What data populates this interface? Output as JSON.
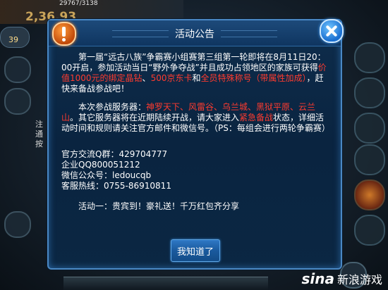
{
  "background": {
    "stat_text": "2,36,93",
    "hp_text": "29767/3138",
    "level_text": "39",
    "side_text": "注通按"
  },
  "dialog": {
    "title": "活动公告",
    "para1_parts": [
      "第一届“远古八族”争霸赛小组赛第三组第一轮即将在8月11日20：00开启，参加活动当日“野外争夺战”并且成功占领地区的家族可获得",
      "价值1000元的绑定晶钻",
      "、",
      "500京东卡",
      "和",
      "全员特殊称号（带属性加成）",
      "，赶快来备战参战吧！"
    ],
    "para2_parts": [
      "本次参战服务器：",
      "神罗天下、风雷谷、乌兰城、黑狱平原、云兰山",
      "。其它服务器将在近期陆续开战，请大家进入",
      "紧急备战",
      "状态，详细活动时间和规则请关注官方邮件和微信号。（PS：每组会进行两轮争霸赛）"
    ],
    "contact": [
      "官方交流Q群：429704777",
      "企业QQ800051212",
      "微信公众号：ledoucqb",
      "客服热线：0755-86910811"
    ],
    "event_line": "活动一：贵宾到！豪礼送！千万红包齐分享",
    "ok_label": "我知道了"
  },
  "watermark": {
    "logo": "sina",
    "text": "新浪游戏"
  },
  "colors": {
    "highlight": "#ff3b2f",
    "dialog_bg": "#0b2743",
    "dialog_border": "#4a88c4"
  }
}
